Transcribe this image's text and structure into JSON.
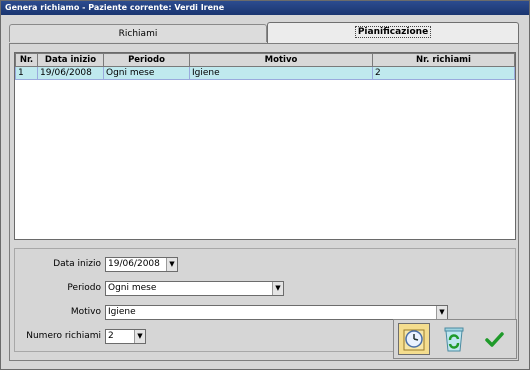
{
  "window": {
    "title": "Genera richiamo - Paziente corrente: Verdi Irene"
  },
  "tabs": [
    {
      "label": "Richiami",
      "active": false
    },
    {
      "label": "Pianificazione",
      "active": true
    }
  ],
  "grid": {
    "columns": [
      "Nr.",
      "Data inizio",
      "Periodo",
      "Motivo",
      "Nr. richiami"
    ],
    "rows": [
      {
        "nr": "1",
        "data_inizio": "19/06/2008",
        "periodo": "Ogni mese",
        "motivo": "Igiene",
        "nr_richiami": "2"
      }
    ]
  },
  "form": {
    "data_inizio": {
      "label": "Data inizio",
      "value": "19/06/2008"
    },
    "periodo": {
      "label": "Periodo",
      "value": "Ogni mese"
    },
    "motivo": {
      "label": "Motivo",
      "value": "Igiene"
    },
    "numero_richiami": {
      "label": "Numero richiami",
      "value": "2"
    }
  },
  "buttons": {
    "schedule_icon": "clock-document-icon",
    "recycle_icon": "recycle-bin-icon",
    "confirm_icon": "checkmark-icon"
  },
  "colors": {
    "selected_row": "#bfe9ee",
    "titlebar": "#1a3570",
    "checkmark": "#1f9a2a"
  }
}
